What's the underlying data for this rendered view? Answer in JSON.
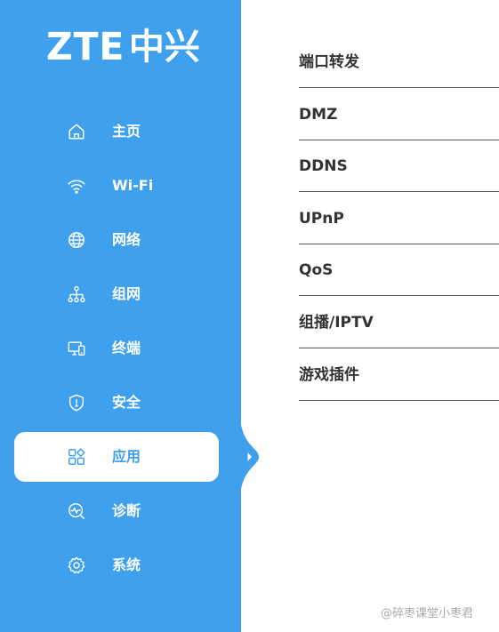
{
  "brand": {
    "logo_latin": "ZTE",
    "logo_cjk": "中兴",
    "accent_color": "#3fa0ee"
  },
  "nav": {
    "items": [
      {
        "label": "主页",
        "icon": "home-icon"
      },
      {
        "label": "Wi-Fi",
        "icon": "wifi-icon"
      },
      {
        "label": "网络",
        "icon": "globe-icon"
      },
      {
        "label": "组网",
        "icon": "network-topology-icon"
      },
      {
        "label": "终端",
        "icon": "devices-icon"
      },
      {
        "label": "安全",
        "icon": "shield-icon"
      },
      {
        "label": "应用",
        "icon": "apps-icon",
        "active": true
      },
      {
        "label": "诊断",
        "icon": "diagnose-icon"
      },
      {
        "label": "系统",
        "icon": "gear-icon"
      }
    ]
  },
  "submenu": {
    "items": [
      {
        "label": "端口转发"
      },
      {
        "label": "DMZ"
      },
      {
        "label": "DDNS"
      },
      {
        "label": "UPnP"
      },
      {
        "label": "QoS"
      },
      {
        "label": "组播/IPTV"
      },
      {
        "label": "游戏插件"
      }
    ]
  },
  "watermark": {
    "text": "@碎枣课堂小枣君"
  }
}
